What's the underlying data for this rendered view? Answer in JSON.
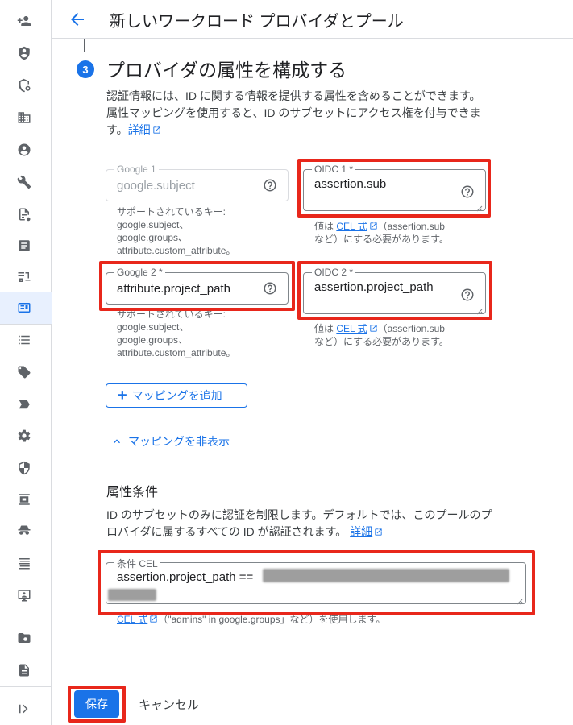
{
  "header": {
    "title": "新しいワークロード プロバイダとプール"
  },
  "step": {
    "number": "3",
    "title": "プロバイダの属性を構成する",
    "description_line1": "認証情報には、ID に関する情報を提供する属性を含めることができます。",
    "description_line2": "属性マッピングを使用すると、ID のサブセットにアクセス権を付与できま",
    "description_line3": "す。",
    "details_link": "詳細"
  },
  "mappings": [
    {
      "google_label": "Google 1",
      "google_value": "google.subject",
      "google_hint": [
        "サポートされているキー:",
        "google.subject、",
        "google.groups、",
        "attribute.custom_attribute。"
      ],
      "oidc_label": "OIDC 1 *",
      "oidc_value": "assertion.sub",
      "oidc_hint_prefix": "値は",
      "oidc_hint_link": "CEL 式",
      "oidc_hint_rest": "（assertion.sub",
      "oidc_hint_line2": "など）にする必要があります。"
    },
    {
      "google_label": "Google 2 *",
      "google_value": "attribute.project_path",
      "google_hint": [
        "サポートされているキー:",
        "google.subject、",
        "google.groups、",
        "attribute.custom_attribute。"
      ],
      "oidc_label": "OIDC 2 *",
      "oidc_value": "assertion.project_path",
      "oidc_hint_prefix": "値は",
      "oidc_hint_link": "CEL 式",
      "oidc_hint_rest": "（assertion.sub",
      "oidc_hint_line2": "など）にする必要があります。"
    }
  ],
  "actions": {
    "add_mapping": "マッピングを追加",
    "hide_mappings": "マッピングを非表示"
  },
  "condition": {
    "section_title": "属性条件",
    "description_line1": "ID のサブセットのみに認証を制限します。デフォルトでは、このプールのプ",
    "description_line2": "ロバイダに属するすべての ID が認証されます。",
    "details_link": "詳細",
    "field_label": "条件 CEL",
    "field_value": "assertion.project_path ==",
    "hint_link": "CEL 式",
    "hint_rest": "（\"admins\" in google.groups」など）を使用します。"
  },
  "footer": {
    "save": "保存",
    "cancel": "キャンセル"
  },
  "colors": {
    "accent": "#1a73e8",
    "highlight": "#e8271b"
  },
  "rail_icons": [
    "person-add-icon",
    "shield-icon",
    "security-settings-icon",
    "organization-icon",
    "account-icon",
    "wrench-icon",
    "policy-doc-icon",
    "document-icon",
    "service-account-icon",
    "workload-identity-icon",
    "list-icon",
    "tag-icon",
    "label-icon",
    "gear-icon",
    "shield-half-icon",
    "privacy-icon",
    "incognito-icon",
    "lines-icon",
    "admin-console-icon",
    "folder-settings-icon",
    "audit-doc-icon",
    "expand-rail-icon"
  ]
}
